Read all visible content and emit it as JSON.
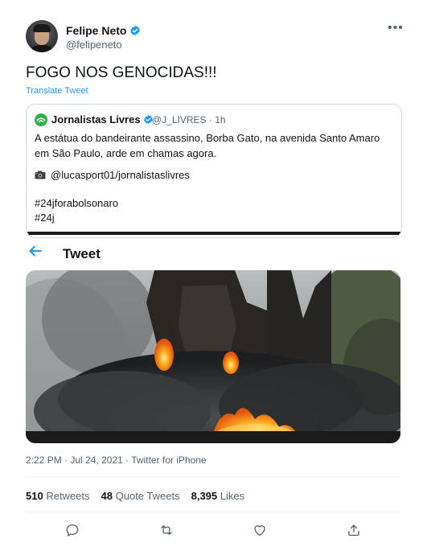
{
  "author": {
    "name": "Felipe Neto",
    "handle": "@felipeneto",
    "verified": true
  },
  "more_label": "•••",
  "tweet_text": "FOGO NOS GENOCIDAS!!!",
  "translate_label": "Translate Tweet",
  "quoted": {
    "name": "Jornalistas Livres",
    "handle_time": "@J_LIVRES · 1h",
    "text": "A estátua do bandeirante assassino, Borba Gato, na avenida Santo Amaro em São Paulo, arde em chamas agora.",
    "credit": "@lucasport01/jornalistaslivres",
    "hashtag1": "#24jforabolsonaro",
    "hashtag2": "#24j"
  },
  "overlay": {
    "back_icon": "left-arrow-icon",
    "title": "Tweet"
  },
  "meta": "2:22 PM · Jul 24, 2021 · Twitter for iPhone",
  "stats": {
    "retweets_count": "510",
    "retweets_label": "Retweets",
    "quotes_count": "48",
    "quotes_label": "Quote Tweets",
    "likes_count": "8,395",
    "likes_label": "Likes"
  },
  "actions": [
    "reply-icon",
    "retweet-icon",
    "like-icon",
    "share-icon"
  ],
  "colors": {
    "accent": "#1d9bf0",
    "secondary_text": "#536471",
    "primary_text": "#0f1419",
    "border": "#cfd9de",
    "brand_green": "#2db34a"
  }
}
